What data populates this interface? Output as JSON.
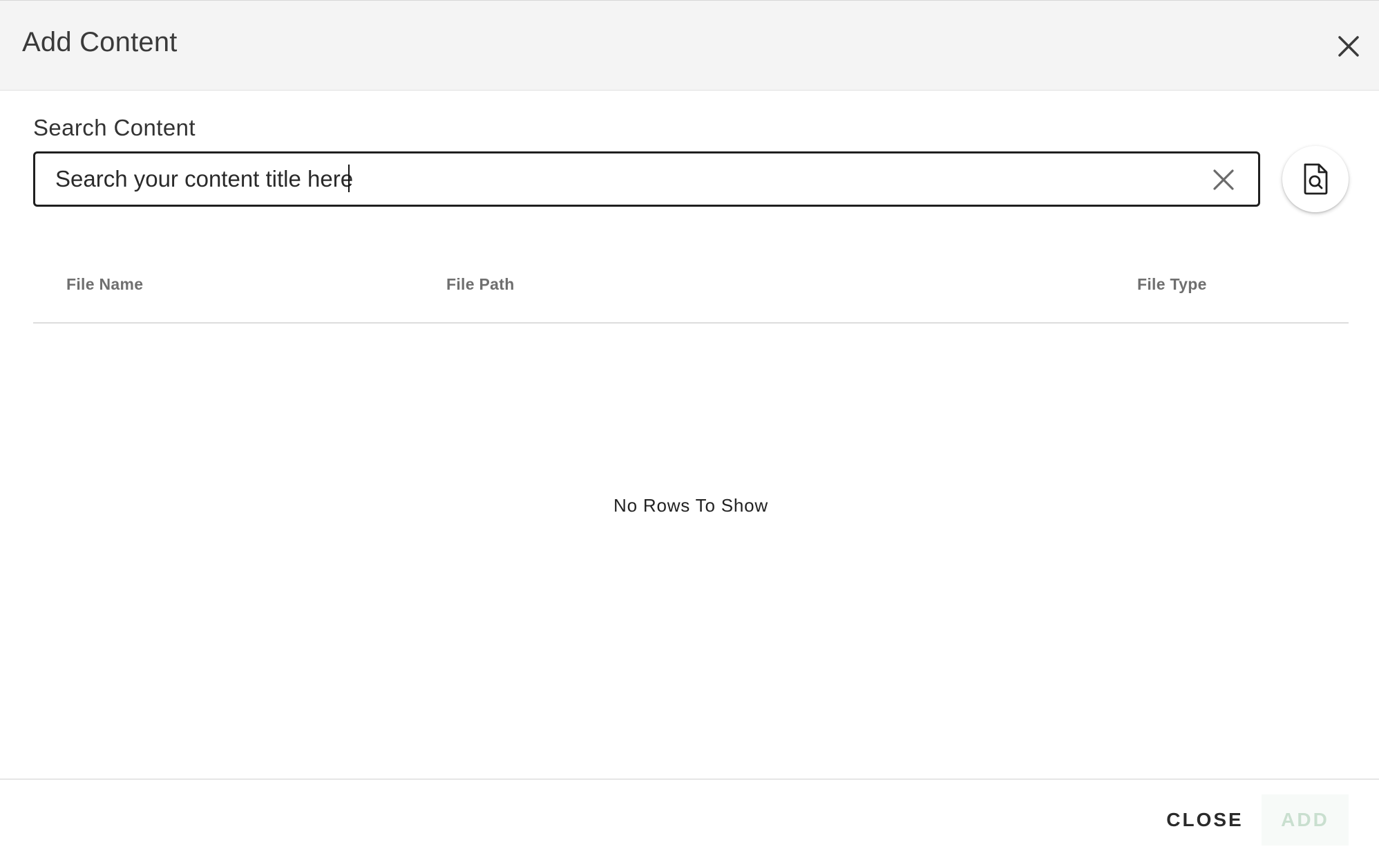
{
  "dialog": {
    "title": "Add Content"
  },
  "search": {
    "label": "Search Content",
    "value": "",
    "placeholder": "Search your content title here"
  },
  "table": {
    "columns": [
      "File Name",
      "File Path",
      "File Type"
    ],
    "rows": [],
    "empty_message": "No Rows To Show"
  },
  "footer": {
    "close_label": "CLOSE",
    "add_label": "ADD",
    "add_disabled": true
  },
  "icons": {
    "header_close": "close-icon",
    "search_clear": "clear-icon",
    "preview": "file-search-icon"
  },
  "colors": {
    "header_bg": "#f4f4f4",
    "add_disabled_text": "#c9dfcf"
  }
}
